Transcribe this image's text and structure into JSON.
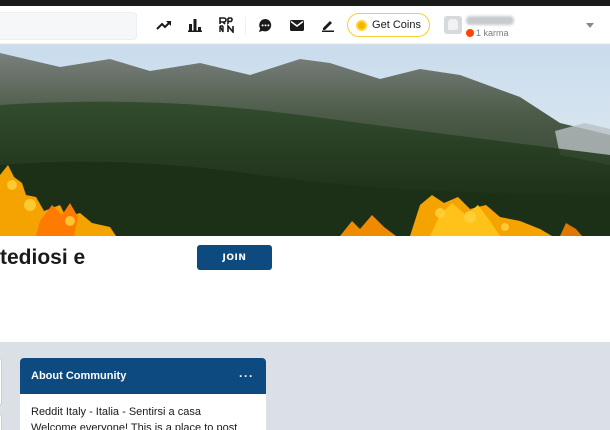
{
  "header": {
    "get_coins_label": "Get Coins",
    "karma": "1 karma",
    "icons": [
      "trending-icon",
      "stats-icon",
      "rpan-icon",
      "chat-icon",
      "mail-icon",
      "create-post-icon",
      "coin-icon",
      "chevron-down-icon"
    ]
  },
  "subreddit": {
    "title": "tediosi e",
    "join_label": "JOIN"
  },
  "about": {
    "title": "About Community",
    "menu": "···",
    "line1": "Reddit Italy - Italia - Sentirsi a casa",
    "line2": "Welcome everyone! This is a place to post"
  },
  "colors": {
    "accent": "#0c4a80",
    "coin_border": "#f4cf35",
    "page_bg": "#dae0e6"
  }
}
